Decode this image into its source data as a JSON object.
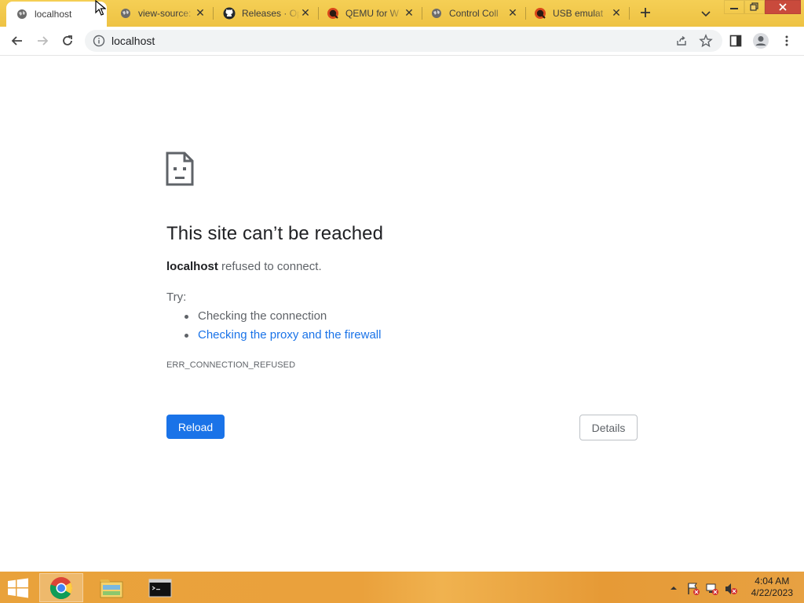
{
  "tabs": [
    {
      "title": "localhost",
      "favicon": "globe-icon",
      "active": true
    },
    {
      "title": "view-source:",
      "favicon": "globe-icon",
      "active": false
    },
    {
      "title": "Releases · Op",
      "favicon": "github-icon",
      "active": false
    },
    {
      "title": "QEMU for W",
      "favicon": "qemu-icon",
      "active": false
    },
    {
      "title": "Control Coll",
      "favicon": "globe-icon",
      "active": false
    },
    {
      "title": "USB emulat",
      "favicon": "qemu-icon",
      "active": false
    }
  ],
  "toolbar": {
    "url": "localhost"
  },
  "error_page": {
    "heading": "This site can’t be reached",
    "host": "localhost",
    "message": "refused to connect.",
    "try_label": "Try:",
    "suggestions": [
      {
        "text": "Checking the connection",
        "link": false
      },
      {
        "text": "Checking the proxy and the firewall",
        "link": true
      }
    ],
    "error_code": "ERR_CONNECTION_REFUSED",
    "reload_label": "Reload",
    "details_label": "Details"
  },
  "taskbar": {
    "time": "4:04 AM",
    "date": "4/22/2023",
    "apps": [
      "chrome-icon",
      "file-explorer-icon",
      "command-prompt-icon"
    ]
  },
  "colors": {
    "accent": "#1a73e8",
    "tabstrip": "#f2c94c",
    "taskbar": "#e9a23b"
  }
}
